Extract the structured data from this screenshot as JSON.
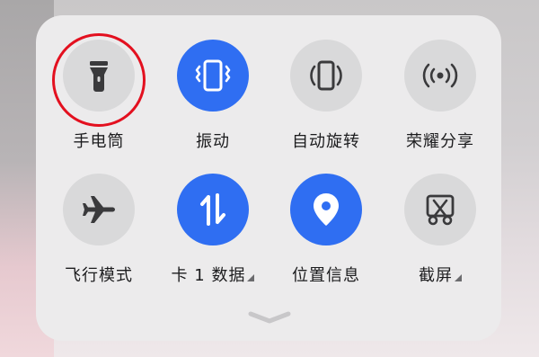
{
  "quick_settings": {
    "row1": [
      {
        "label": "手电筒",
        "icon": "flashlight-icon",
        "active": false
      },
      {
        "label": "振动",
        "icon": "vibrate-icon",
        "active": true
      },
      {
        "label": "自动旋转",
        "icon": "auto-rotate-icon",
        "active": false
      },
      {
        "label": "荣耀分享",
        "icon": "honor-share-icon",
        "active": false
      }
    ],
    "row2": [
      {
        "label": "飞行模式",
        "icon": "airplane-icon",
        "active": false
      },
      {
        "label": "卡 1 数据",
        "icon": "mobile-data-icon",
        "active": true,
        "expandable": true
      },
      {
        "label": "位置信息",
        "icon": "location-icon",
        "active": true
      },
      {
        "label": "截屏",
        "icon": "screenshot-icon",
        "active": false,
        "expandable": true
      }
    ]
  },
  "colors": {
    "active": "#2f6ef2",
    "inactive": "#d9d9da",
    "highlight_ring": "#e3101f"
  },
  "expand_control": {
    "icon": "chevron-down-icon"
  }
}
